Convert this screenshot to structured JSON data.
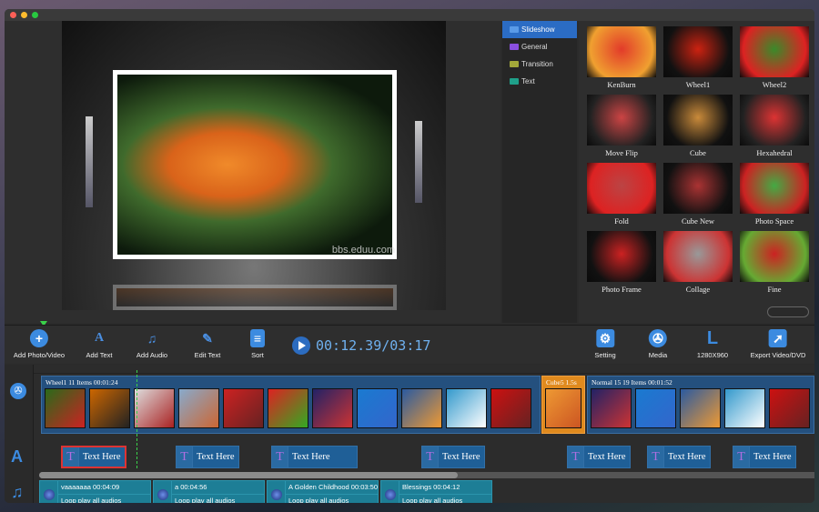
{
  "window": {
    "controls": [
      "close",
      "minimize",
      "zoom"
    ]
  },
  "preview": {
    "watermark": "bbs.eduu.com",
    "progress_percent": 6
  },
  "categories": [
    {
      "label": "Slideshow",
      "color": "#5a9be8",
      "selected": true
    },
    {
      "label": "General",
      "color": "#8a4fe0"
    },
    {
      "label": "Transition",
      "color": "#a3a83a"
    },
    {
      "label": "Text",
      "color": "#1fa08a"
    }
  ],
  "effects": [
    "KenBurn",
    "Wheel1",
    "Wheel2",
    "Move Flip",
    "Cube",
    "Hexahedral",
    "Fold",
    "Cube New",
    "Photo Space",
    "Photo Frame",
    "Collage",
    "Fine"
  ],
  "toolbar": {
    "add_photo": "Add Photo/Video",
    "add_text": "Add Text",
    "add_audio": "Add Audio",
    "edit_text": "Edit Text",
    "sort": "Sort",
    "time": "00:12.39/03:17",
    "setting": "Setting",
    "media": "Media",
    "resolution": "1280X960",
    "export": "Export Video/DVD"
  },
  "timeline": {
    "groups": [
      {
        "label": "Wheel1    11 Items    00:01:24",
        "count": 11,
        "color": "#24507e"
      },
      {
        "label": "Cube5  1.5s",
        "count": 1,
        "color": "#e08a1e"
      },
      {
        "label": "Normal 15    19 Items    00:01:52",
        "count": 5,
        "color": "#24507e"
      }
    ],
    "text_clip": "Text Here",
    "audio": [
      {
        "title": "vaaaaaaa  00:04:09",
        "loop": "Loop play all audios"
      },
      {
        "title": "a  00:04:56",
        "loop": "Loop play all audios"
      },
      {
        "title": "A Golden Childhood  00:03:50",
        "loop": "Loop play all audios"
      },
      {
        "title": "Blessings  00:04:12",
        "loop": "Loop play all audios"
      }
    ]
  }
}
